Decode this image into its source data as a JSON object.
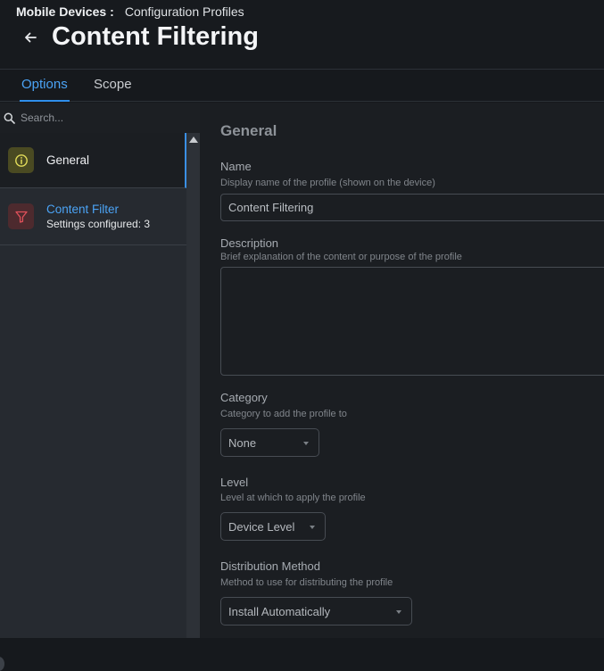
{
  "header": {
    "breadcrumb_parent": "Mobile Devices",
    "breadcrumb_separator": ":",
    "breadcrumb_current": "Configuration Profiles",
    "title": "Content Filtering"
  },
  "tabs": [
    {
      "label": "Options",
      "active": true
    },
    {
      "label": "Scope",
      "active": false
    }
  ],
  "sidebar": {
    "search_placeholder": "Search...",
    "items": [
      {
        "label": "General",
        "icon": "info-icon",
        "active": true
      },
      {
        "label": "Content Filter",
        "subtitle": "Settings configured: 3",
        "icon": "filter-icon",
        "active": false
      }
    ]
  },
  "general": {
    "section_title": "General",
    "name": {
      "label": "Name",
      "help": "Display name of the profile (shown on the device)",
      "value": "Content Filtering"
    },
    "description": {
      "label": "Description",
      "help": "Brief explanation of the content or purpose of the profile",
      "value": ""
    },
    "category": {
      "label": "Category",
      "help": "Category to add the profile to",
      "value": "None"
    },
    "level": {
      "label": "Level",
      "help": "Level at which to apply the profile",
      "value": "Device Level"
    },
    "distribution": {
      "label": "Distribution Method",
      "help": "Method to use for distributing the profile",
      "value": "Install Automatically"
    }
  },
  "colors": {
    "accent": "#2f8fec",
    "info_icon": "#e2dc5a",
    "filter_icon": "#e0505a"
  }
}
